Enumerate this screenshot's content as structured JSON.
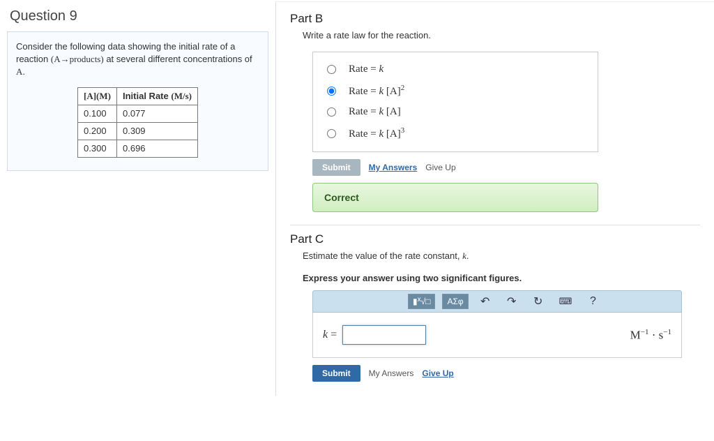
{
  "question": {
    "title": "Question 9",
    "stem_html": "Consider the following data showing the initial rate of a reaction (A→products) at several different concentrations of A.",
    "table": {
      "headers": [
        "[A](M)",
        "Initial Rate (M/s)"
      ],
      "rows": [
        [
          "0.100",
          "0.077"
        ],
        [
          "0.200",
          "0.309"
        ],
        [
          "0.300",
          "0.696"
        ]
      ]
    }
  },
  "partB": {
    "title": "Part B",
    "prompt": "Write a rate law for the reaction.",
    "choices": [
      {
        "label": "Rate = k",
        "selected": false
      },
      {
        "label": "Rate = k [A]²",
        "selected": true
      },
      {
        "label": "Rate = k [A]",
        "selected": false
      },
      {
        "label": "Rate = k [A]³",
        "selected": false
      }
    ],
    "submit": "Submit",
    "my_answers": "My Answers",
    "give_up": "Give Up",
    "feedback": "Correct"
  },
  "partC": {
    "title": "Part C",
    "prompt": "Estimate the value of the rate constant, k.",
    "instruction": "Express your answer using two significant figures.",
    "toolbar": {
      "template": "√□",
      "greek": "ΑΣφ",
      "undo": "↶",
      "redo": "↷",
      "reset": "↻",
      "keyboard": "⌨",
      "help": "?"
    },
    "var_label": "k =",
    "value": "",
    "units_html": "M⁻¹ · s⁻¹",
    "submit": "Submit",
    "my_answers": "My Answers",
    "give_up": "Give Up"
  }
}
